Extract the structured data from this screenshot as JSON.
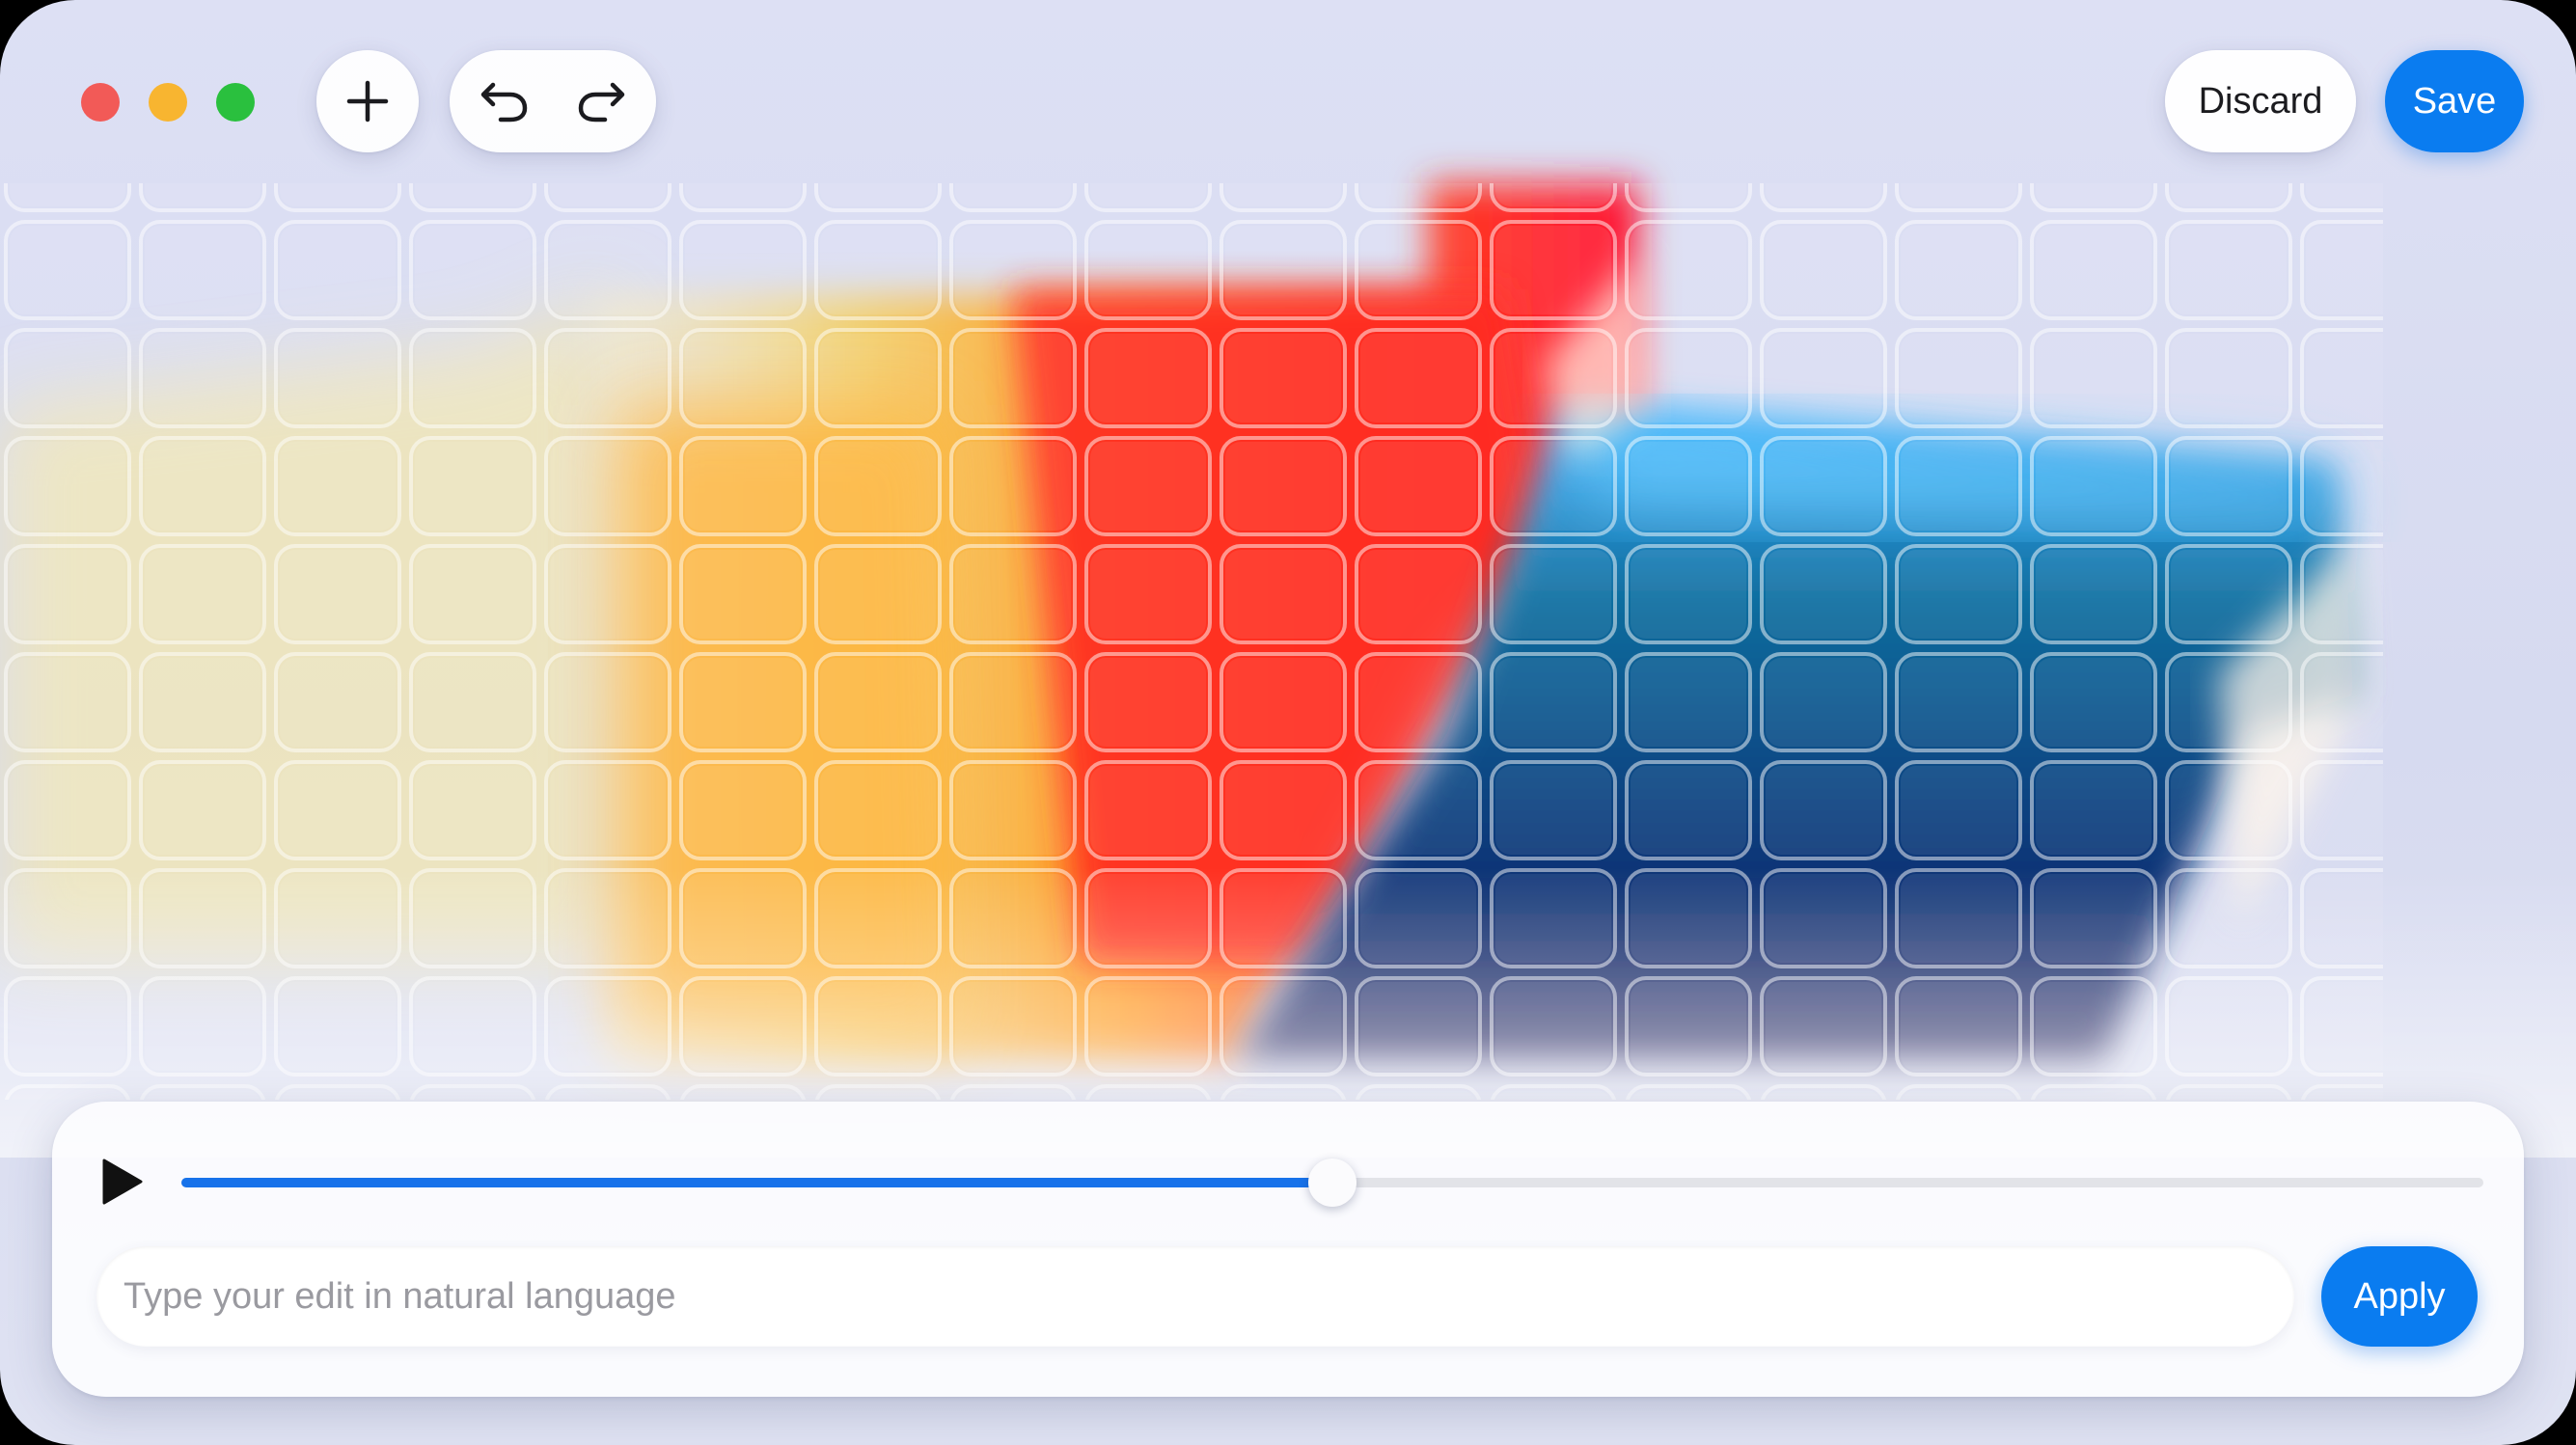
{
  "window": {
    "traffic_lights": [
      {
        "name": "close",
        "color": "#f25a57"
      },
      {
        "name": "minimize",
        "color": "#f8b530"
      },
      {
        "name": "zoom",
        "color": "#2ac03e"
      }
    ]
  },
  "toolbar": {
    "add_icon": "plus-icon",
    "undo_icon": "undo-arrow-icon",
    "redo_icon": "redo-arrow-icon",
    "discard_label": "Discard",
    "save_label": "Save"
  },
  "player": {
    "play_icon": "play-icon",
    "progress": 0.5
  },
  "prompt": {
    "placeholder": "Type your edit in natural language",
    "value": "",
    "apply_label": "Apply"
  },
  "colors": {
    "accent": "#0a7cf0",
    "progress": "#1772ea",
    "background": "#d8dcf1"
  }
}
